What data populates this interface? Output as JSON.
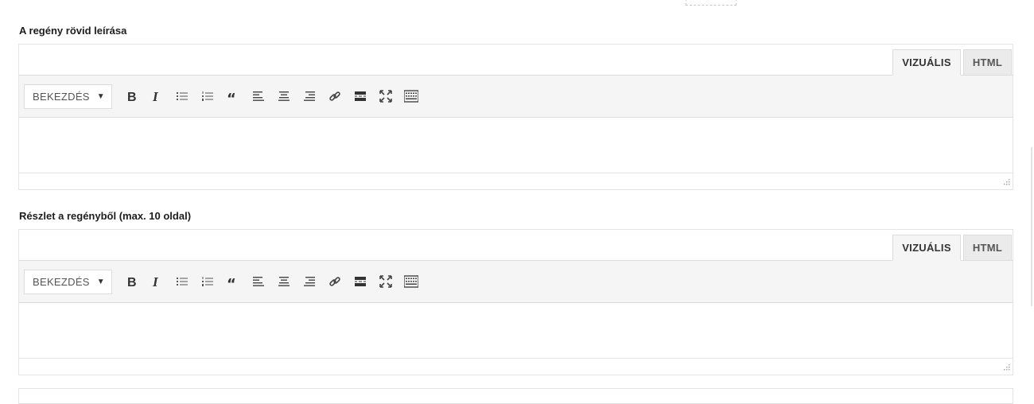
{
  "fields": [
    {
      "label": "A regény rövid leírása",
      "tabs": {
        "visual": "VIZUÁLIS",
        "html": "HTML"
      },
      "format_select": "BEKEZDÉS",
      "content": ""
    },
    {
      "label": "Részlet a regényből (max. 10 oldal)",
      "tabs": {
        "visual": "VIZUÁLIS",
        "html": "HTML"
      },
      "format_select": "BEKEZDÉS",
      "content": ""
    }
  ],
  "toolbar_icons": [
    "bold-icon",
    "italic-icon",
    "bullet-list-icon",
    "numbered-list-icon",
    "blockquote-icon",
    "align-left-icon",
    "align-center-icon",
    "align-right-icon",
    "link-icon",
    "read-more-icon",
    "fullscreen-icon",
    "toolbar-toggle-icon"
  ]
}
